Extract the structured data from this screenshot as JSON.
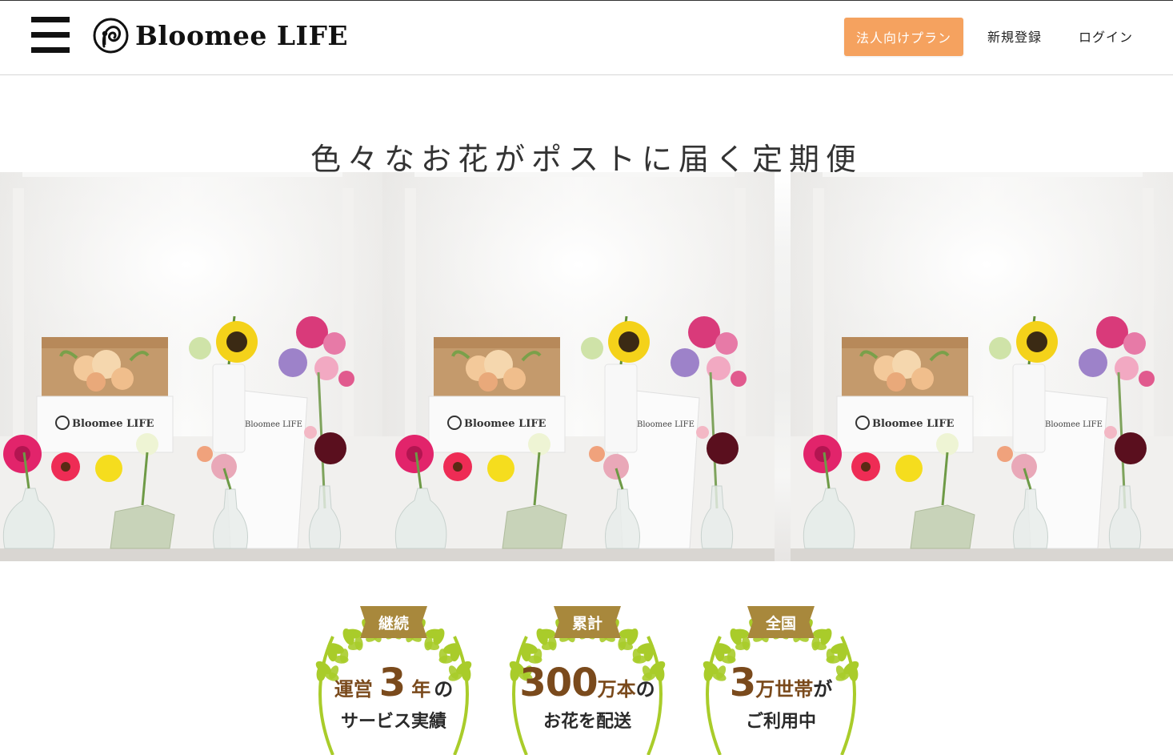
{
  "header": {
    "brand": "Bloomee LIFE",
    "corporate_plan_label": "法人向けプラン",
    "register_label": "新規登録",
    "login_label": "ログイン"
  },
  "hero": {
    "title": "色々なお花がポストに届く定期便",
    "box_label": "Bloomee LIFE",
    "bag_label": "Bloomee LIFE"
  },
  "badges": [
    {
      "ribbon": "継続",
      "pre": "運営",
      "big": "3",
      "post": "年",
      "tail": "の",
      "line2": "サービス実績"
    },
    {
      "ribbon": "累計",
      "pre": "",
      "big": "300",
      "post": "万本",
      "tail": "の",
      "line2": "お花を配送"
    },
    {
      "ribbon": "全国",
      "pre": "",
      "big": "3",
      "post": "万世帯",
      "tail": "が",
      "line2": "ご利用中"
    }
  ],
  "colors": {
    "accent": "#f5a25f",
    "ribbon": "#a8883c",
    "badge_text": "#7a4a1c",
    "wreath": "#a9cc2a"
  }
}
